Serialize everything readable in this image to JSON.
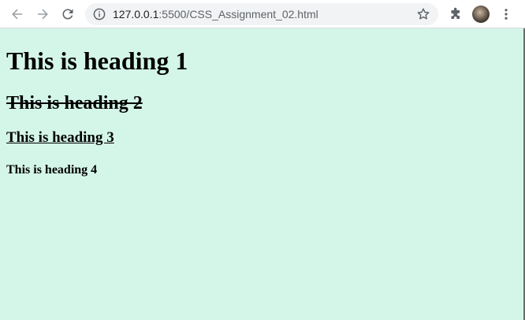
{
  "browser": {
    "url_host": "127.0.0.1",
    "url_rest": ":5500/CSS_Assignment_02.html",
    "icons": {
      "back": "back-arrow-icon",
      "forward": "forward-arrow-icon",
      "reload": "reload-icon",
      "site_info": "info-icon",
      "bookmark": "star-icon",
      "extensions": "puzzle-icon",
      "profile": "avatar",
      "menu": "kebab-menu-icon"
    }
  },
  "page": {
    "background": "#d4f6e9",
    "h1": "This is heading 1",
    "h2": "This is heading 2",
    "h3": "This is heading 3",
    "h4": "This is heading 4"
  }
}
